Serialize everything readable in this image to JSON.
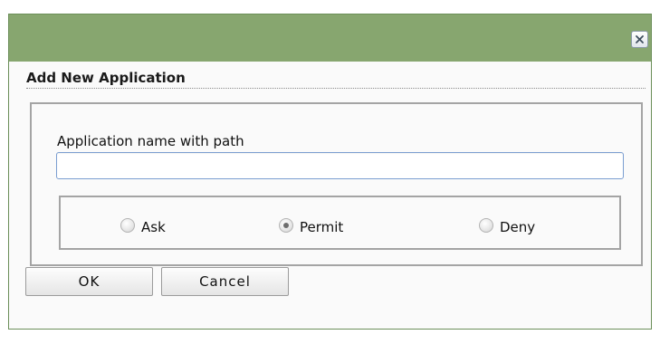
{
  "dialog": {
    "heading": "Add New Application",
    "close_icon": "close-icon"
  },
  "form": {
    "field_label": "Application name with path",
    "app_path_value": "",
    "app_path_placeholder": ""
  },
  "radios": {
    "selected": "Permit",
    "options": [
      {
        "label": "Ask",
        "checked": false
      },
      {
        "label": "Permit",
        "checked": true
      },
      {
        "label": "Deny",
        "checked": false
      }
    ]
  },
  "buttons": {
    "ok_label": "OK",
    "cancel_label": "Cancel"
  },
  "colors": {
    "titlebar": "#87a66f",
    "input_focus_border": "#7b9ed1"
  }
}
